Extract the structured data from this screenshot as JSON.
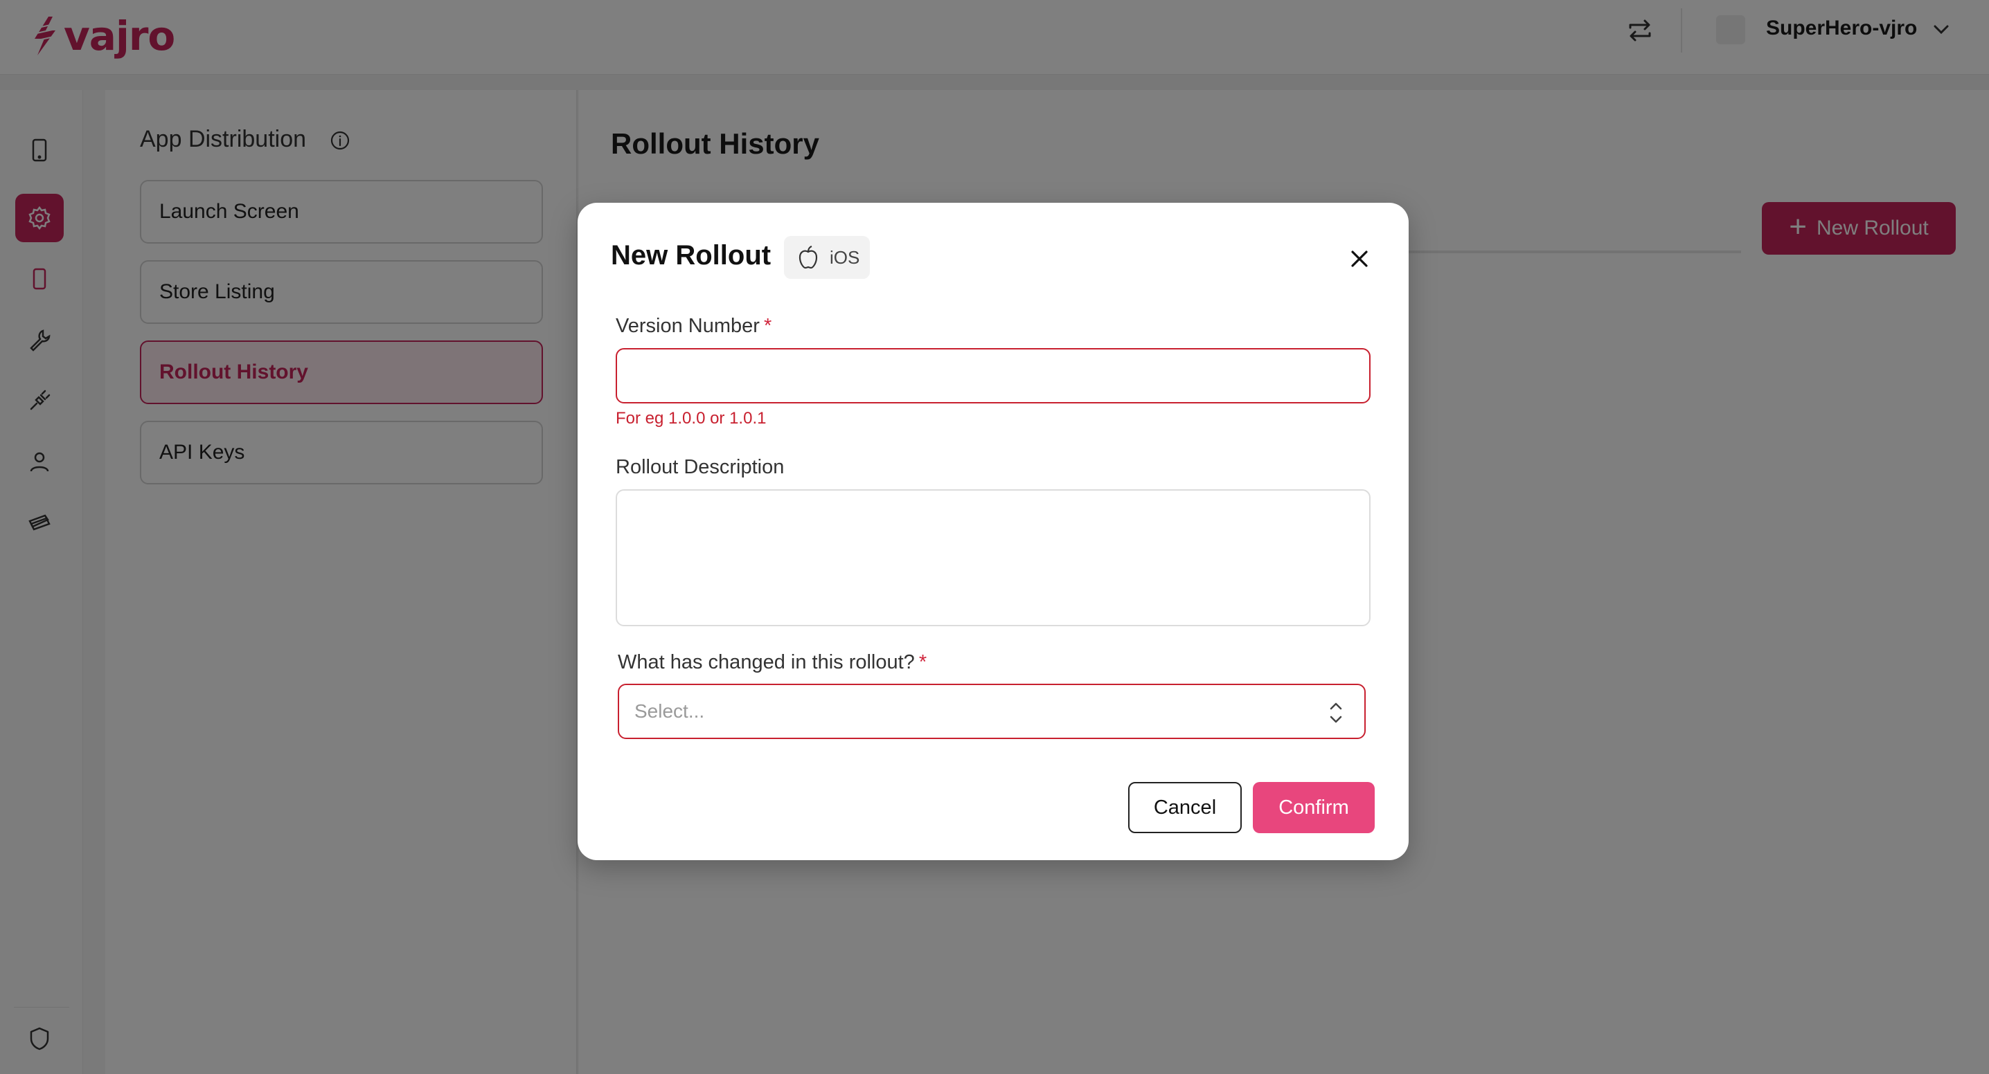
{
  "app": {
    "logo_text": "vajro",
    "brand_color": "#c5255a"
  },
  "header": {
    "user_name": "SuperHero-vjro"
  },
  "rail": {
    "icons": [
      "mobile-icon",
      "settings-icon",
      "phone-icon",
      "wrench-icon",
      "plug-icon",
      "user-icon",
      "ticket-icon",
      "shield-icon"
    ],
    "active": "settings-icon"
  },
  "settings_nav": {
    "title": "App Distribution",
    "items": [
      {
        "label": "Launch Screen"
      },
      {
        "label": "Store Listing"
      },
      {
        "label": "Rollout History",
        "active": true
      },
      {
        "label": "API Keys"
      }
    ]
  },
  "main": {
    "title": "Rollout History",
    "new_rollout_label": "New Rollout"
  },
  "modal": {
    "title": "New Rollout",
    "platform": "iOS",
    "version_label": "Version Number",
    "version_value": "",
    "version_hint": "For eg 1.0.0 or 1.0.1",
    "description_label": "Rollout Description",
    "description_value": "",
    "changes_label": "What has changed in this rollout?",
    "changes_placeholder": "Select...",
    "required_mark": "*",
    "cancel_label": "Cancel",
    "confirm_label": "Confirm",
    "error_color": "#c8202f",
    "confirm_color": "#e8467d"
  }
}
